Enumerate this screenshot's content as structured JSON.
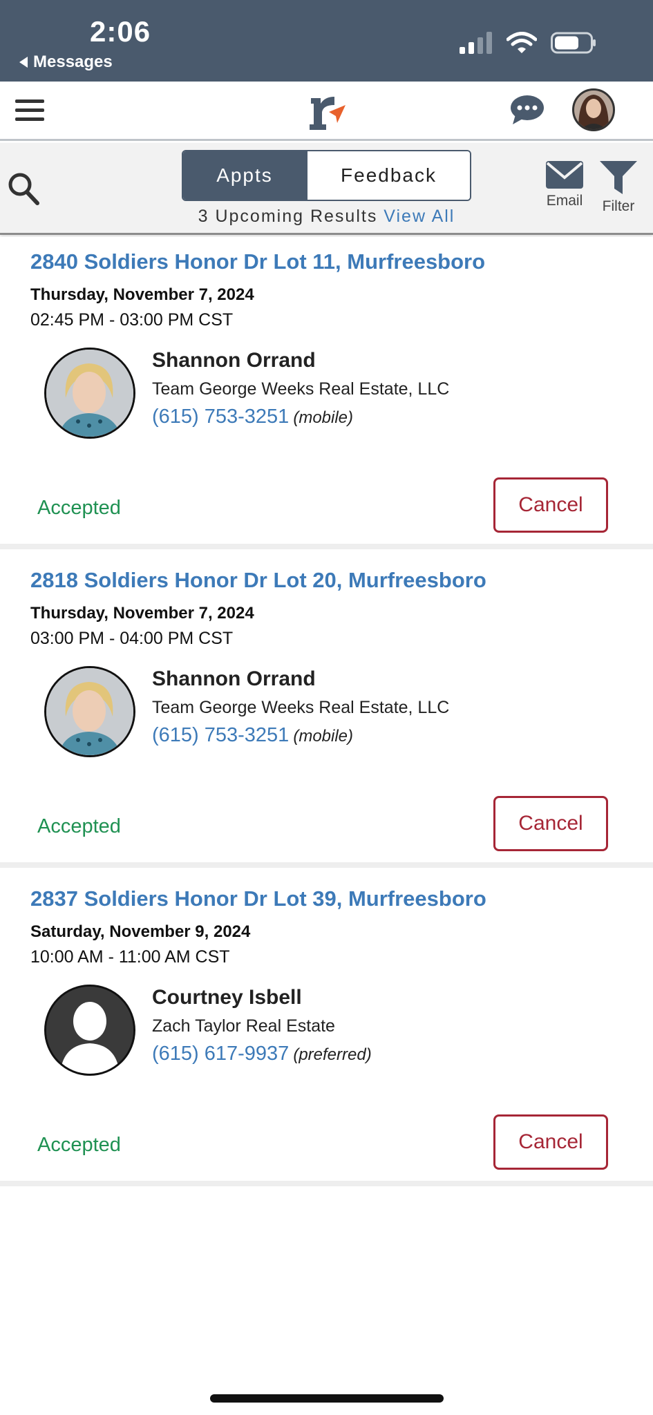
{
  "status_bar": {
    "time": "2:06",
    "back_label": "Messages"
  },
  "nav": {
    "menu_icon": "hamburger-menu-icon",
    "logo_icon": "r-logo-icon",
    "chat_icon": "chat-bubble-icon"
  },
  "toolbar": {
    "tabs": [
      {
        "label": "Appts",
        "active": true
      },
      {
        "label": "Feedback",
        "active": false
      }
    ],
    "results_text": "3 Upcoming Results",
    "view_all": "View All",
    "email_label": "Email",
    "filter_label": "Filter"
  },
  "appointments": [
    {
      "address": "2840 Soldiers Honor Dr Lot 11, Murfreesboro",
      "date": "Thursday, November 7, 2024",
      "time": "02:45 PM - 03:00 PM CST",
      "agent_name": "Shannon Orrand",
      "company": "Team George Weeks Real Estate, LLC",
      "phone": "(615) 753-3251",
      "phone_type": "(mobile)",
      "status": "Accepted",
      "cancel_label": "Cancel",
      "photo": "agent-photo"
    },
    {
      "address": "2818 Soldiers Honor Dr Lot 20, Murfreesboro",
      "date": "Thursday, November 7, 2024",
      "time": "03:00 PM - 04:00 PM CST",
      "agent_name": "Shannon Orrand",
      "company": "Team George Weeks Real Estate, LLC",
      "phone": "(615) 753-3251",
      "phone_type": "(mobile)",
      "status": "Accepted",
      "cancel_label": "Cancel",
      "photo": "agent-photo"
    },
    {
      "address": "2837 Soldiers Honor Dr Lot 39, Murfreesboro",
      "date": "Saturday, November 9, 2024",
      "time": "10:00 AM - 11:00 AM CST",
      "agent_name": "Courtney Isbell",
      "company": "Zach Taylor Real Estate",
      "phone": "(615) 617-9937",
      "phone_type": "(preferred)",
      "status": "Accepted",
      "cancel_label": "Cancel",
      "photo": "default-avatar"
    }
  ],
  "colors": {
    "header": "#4a5a6d",
    "link": "#3d7ab8",
    "accepted": "#1f9152",
    "cancel": "#a62636",
    "logo_accent": "#e8612c"
  }
}
